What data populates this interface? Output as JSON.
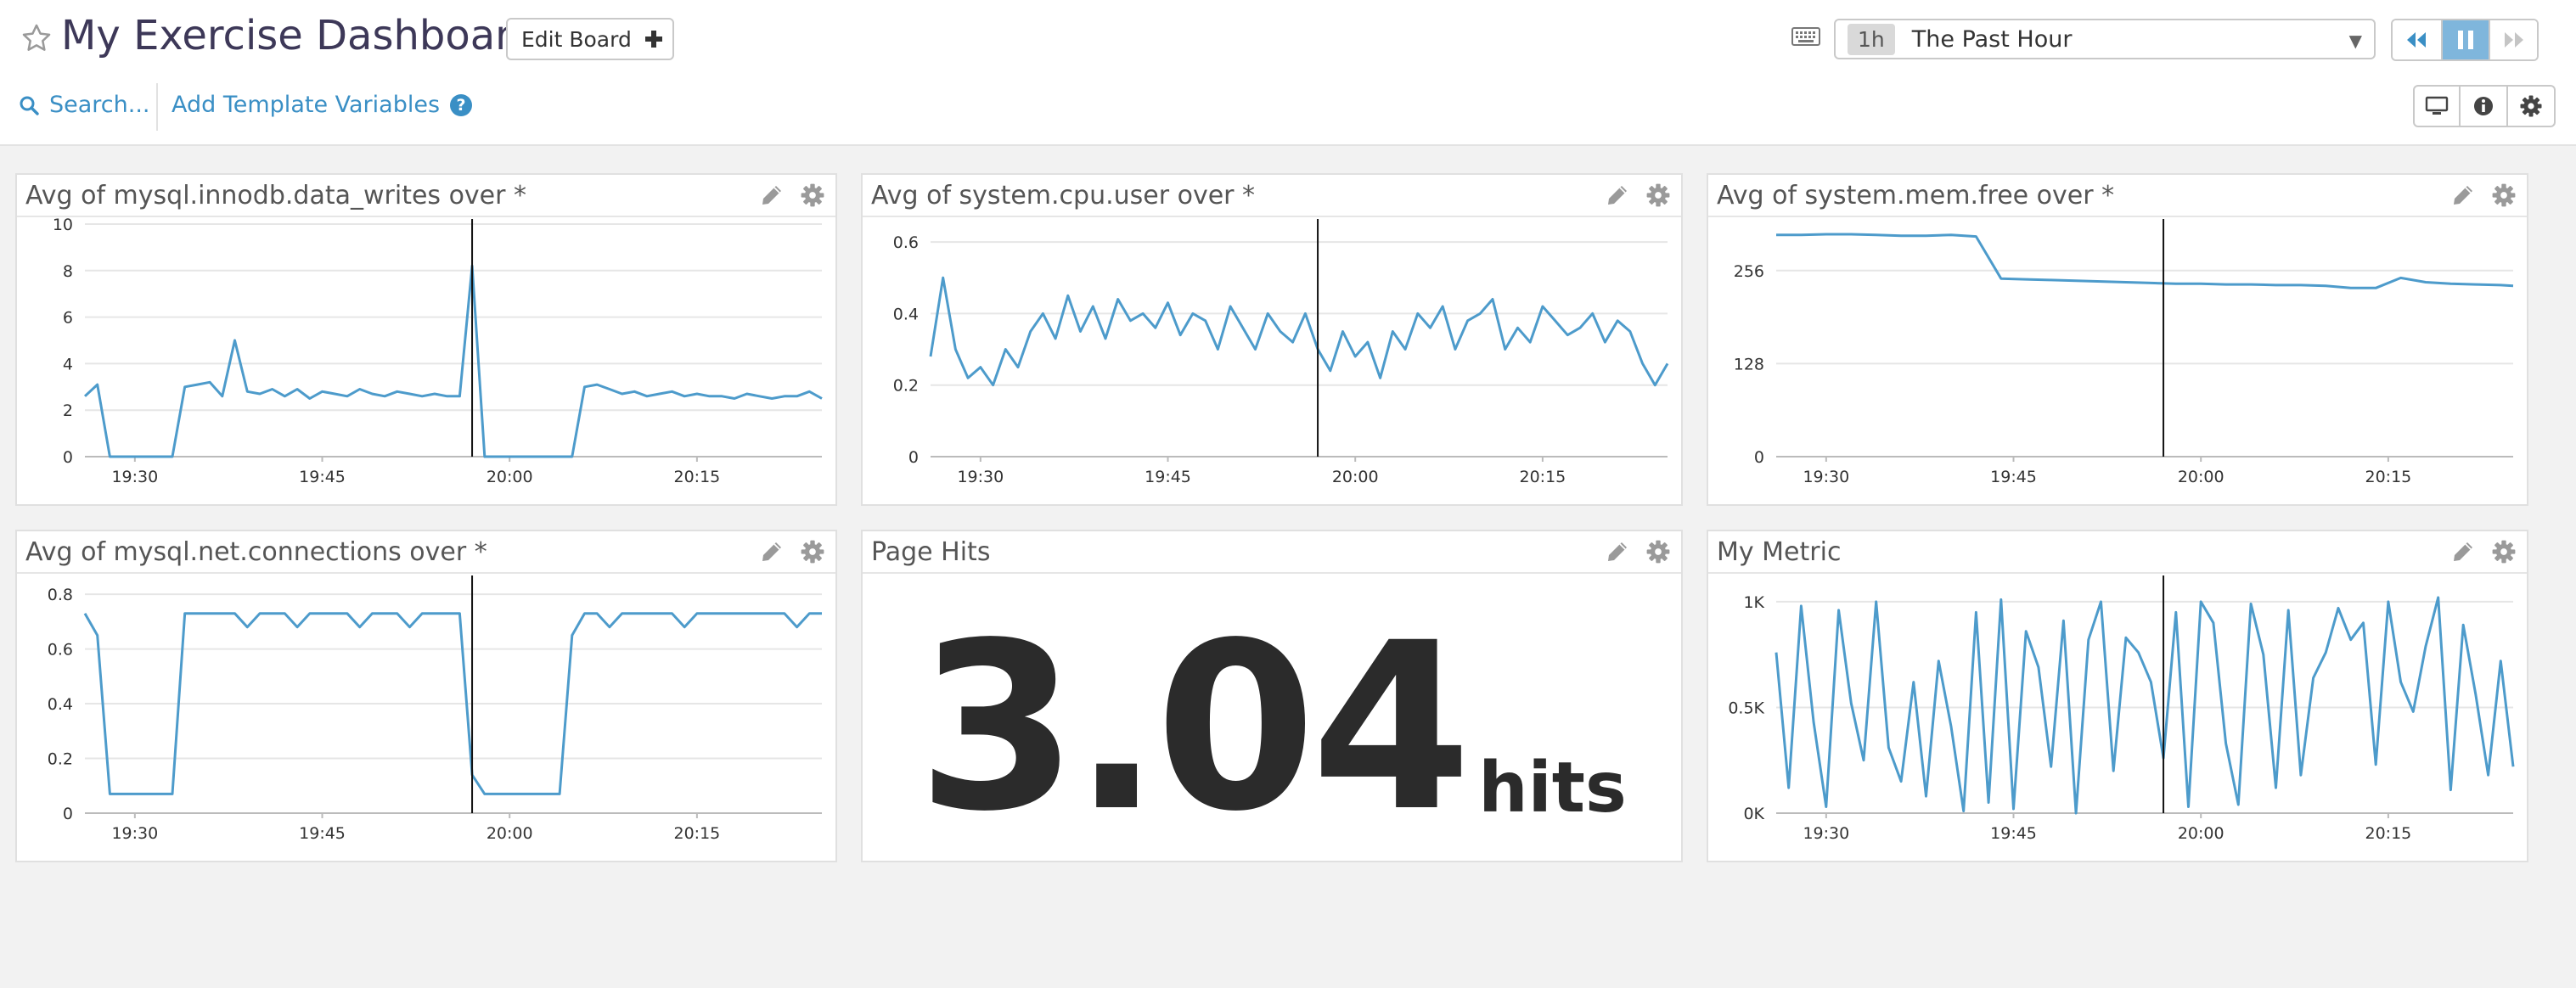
{
  "header": {
    "title": "My Exercise Dashboard",
    "edit_board_label": "Edit Board",
    "time_badge": "1h",
    "time_label": "The Past Hour",
    "search_label": "Search...",
    "template_label": "Add Template Variables"
  },
  "icons": {
    "favorite": "star-icon",
    "edit_board": "plus-icon",
    "keyboard": "keyboard-icon",
    "rewind": "rewind-icon",
    "pause": "pause-icon",
    "forward": "fast-forward-icon",
    "search": "search-icon",
    "help": "question-circle-icon",
    "tv": "tv-mode-icon",
    "info": "info-icon",
    "settings": "gear-icon",
    "widget_edit": "pencil-icon",
    "widget_settings": "gear-icon"
  },
  "colors": {
    "series": "#4d9bcb",
    "link": "#3a8fc5",
    "title": "#3d3858",
    "active_button": "#7fb6dc"
  },
  "widgets": [
    {
      "title": "Avg of mysql.innodb.data_writes over *"
    },
    {
      "title": "Avg of system.cpu.user over *"
    },
    {
      "title": "Avg of system.mem.free over *"
    },
    {
      "title": "Avg of mysql.net.connections over *"
    },
    {
      "title": "Page Hits"
    },
    {
      "title": "My Metric"
    }
  ],
  "page_hits": {
    "value": "3.04",
    "unit": "hits"
  },
  "chart_data": [
    {
      "type": "line",
      "title": "Avg of mysql.innodb.data_writes over *",
      "x": [
        "19:26",
        "19:27",
        "19:28",
        "19:29",
        "19:30",
        "19:31",
        "19:32",
        "19:33",
        "19:34",
        "19:35",
        "19:36",
        "19:37",
        "19:38",
        "19:39",
        "19:40",
        "19:41",
        "19:42",
        "19:43",
        "19:44",
        "19:45",
        "19:46",
        "19:47",
        "19:48",
        "19:49",
        "19:50",
        "19:51",
        "19:52",
        "19:53",
        "19:54",
        "19:55",
        "19:56",
        "19:57",
        "19:58",
        "19:59",
        "20:00",
        "20:01",
        "20:02",
        "20:03",
        "20:04",
        "20:05",
        "20:06",
        "20:07",
        "20:08",
        "20:09",
        "20:10",
        "20:11",
        "20:12",
        "20:13",
        "20:14",
        "20:15",
        "20:16",
        "20:17",
        "20:18",
        "20:19",
        "20:20",
        "20:21",
        "20:22",
        "20:23",
        "20:24",
        "20:25"
      ],
      "series": [
        {
          "values": [
            2.6,
            3.1,
            0,
            0,
            0,
            0,
            0,
            0,
            3.0,
            3.1,
            3.2,
            2.6,
            5.0,
            2.8,
            2.7,
            2.9,
            2.6,
            2.9,
            2.5,
            2.8,
            2.7,
            2.6,
            2.9,
            2.7,
            2.6,
            2.8,
            2.7,
            2.6,
            2.7,
            2.6,
            2.6,
            8.2,
            0,
            0,
            0,
            0,
            0,
            0,
            0,
            0,
            3.0,
            3.1,
            2.9,
            2.7,
            2.8,
            2.6,
            2.7,
            2.8,
            2.6,
            2.7,
            2.6,
            2.6,
            2.5,
            2.7,
            2.6,
            2.5,
            2.6,
            2.6,
            2.8,
            2.5
          ]
        }
      ],
      "ylim": [
        0,
        10
      ],
      "yticks": [
        "0",
        "2",
        "4",
        "6",
        "8",
        "10"
      ],
      "xticks": [
        "19:30",
        "19:45",
        "20:00",
        "20:15"
      ],
      "grid": true
    },
    {
      "type": "line",
      "title": "Avg of system.cpu.user over *",
      "x": [
        "19:26",
        "19:27",
        "19:28",
        "19:29",
        "19:30",
        "19:31",
        "19:32",
        "19:33",
        "19:34",
        "19:35",
        "19:36",
        "19:37",
        "19:38",
        "19:39",
        "19:40",
        "19:41",
        "19:42",
        "19:43",
        "19:44",
        "19:45",
        "19:46",
        "19:47",
        "19:48",
        "19:49",
        "19:50",
        "19:51",
        "19:52",
        "19:53",
        "19:54",
        "19:55",
        "19:56",
        "19:57",
        "19:58",
        "19:59",
        "20:00",
        "20:01",
        "20:02",
        "20:03",
        "20:04",
        "20:05",
        "20:06",
        "20:07",
        "20:08",
        "20:09",
        "20:10",
        "20:11",
        "20:12",
        "20:13",
        "20:14",
        "20:15",
        "20:16",
        "20:17",
        "20:18",
        "20:19",
        "20:20",
        "20:21",
        "20:22",
        "20:23",
        "20:24",
        "20:25"
      ],
      "series": [
        {
          "values": [
            0.28,
            0.5,
            0.3,
            0.22,
            0.25,
            0.2,
            0.3,
            0.25,
            0.35,
            0.4,
            0.33,
            0.45,
            0.35,
            0.42,
            0.33,
            0.44,
            0.38,
            0.4,
            0.36,
            0.43,
            0.34,
            0.4,
            0.38,
            0.3,
            0.42,
            0.36,
            0.3,
            0.4,
            0.35,
            0.32,
            0.4,
            0.3,
            0.24,
            0.35,
            0.28,
            0.32,
            0.22,
            0.35,
            0.3,
            0.4,
            0.36,
            0.42,
            0.3,
            0.38,
            0.4,
            0.44,
            0.3,
            0.36,
            0.32,
            0.42,
            0.38,
            0.34,
            0.36,
            0.4,
            0.32,
            0.38,
            0.35,
            0.26,
            0.2,
            0.26
          ]
        }
      ],
      "ylim": [
        0,
        0.65
      ],
      "yticks": [
        "0",
        "0.2",
        "0.4",
        "0.6"
      ],
      "xticks": [
        "19:30",
        "19:45",
        "20:00",
        "20:15"
      ],
      "grid": true
    },
    {
      "type": "line",
      "title": "Avg of system.mem.free over *",
      "x": [
        "19:26",
        "19:28",
        "19:30",
        "19:32",
        "19:34",
        "19:36",
        "19:38",
        "19:40",
        "19:42",
        "19:44",
        "19:46",
        "19:48",
        "19:50",
        "19:52",
        "19:54",
        "19:56",
        "19:58",
        "20:00",
        "20:02",
        "20:04",
        "20:06",
        "20:08",
        "20:10",
        "20:12",
        "20:14",
        "20:16",
        "20:18",
        "20:20",
        "20:22",
        "20:24",
        "20:25"
      ],
      "series": [
        {
          "values": [
            305,
            305,
            306,
            306,
            305,
            304,
            304,
            305,
            303,
            245,
            244,
            243,
            242,
            241,
            240,
            239,
            238,
            238,
            237,
            237,
            236,
            236,
            235,
            232,
            232,
            246,
            240,
            238,
            237,
            236,
            235
          ]
        }
      ],
      "ylim": [
        0,
        320
      ],
      "yticks": [
        "0",
        "128",
        "256"
      ],
      "xticks": [
        "19:30",
        "19:45",
        "20:00",
        "20:15"
      ],
      "grid": true
    },
    {
      "type": "line",
      "title": "Avg of mysql.net.connections over *",
      "x": [
        "19:26",
        "19:27",
        "19:28",
        "19:29",
        "19:30",
        "19:31",
        "19:32",
        "19:33",
        "19:34",
        "19:35",
        "19:36",
        "19:37",
        "19:38",
        "19:39",
        "19:40",
        "19:41",
        "19:42",
        "19:43",
        "19:44",
        "19:45",
        "19:46",
        "19:47",
        "19:48",
        "19:49",
        "19:50",
        "19:51",
        "19:52",
        "19:53",
        "19:54",
        "19:55",
        "19:56",
        "19:57",
        "19:58",
        "19:59",
        "20:00",
        "20:01",
        "20:02",
        "20:03",
        "20:04",
        "20:05",
        "20:06",
        "20:07",
        "20:08",
        "20:09",
        "20:10",
        "20:11",
        "20:12",
        "20:13",
        "20:14",
        "20:15",
        "20:16",
        "20:17",
        "20:18",
        "20:19",
        "20:20",
        "20:21",
        "20:22",
        "20:23",
        "20:24",
        "20:25"
      ],
      "series": [
        {
          "values": [
            0.73,
            0.65,
            0.07,
            0.07,
            0.07,
            0.07,
            0.07,
            0.07,
            0.73,
            0.73,
            0.73,
            0.73,
            0.73,
            0.68,
            0.73,
            0.73,
            0.73,
            0.68,
            0.73,
            0.73,
            0.73,
            0.73,
            0.68,
            0.73,
            0.73,
            0.73,
            0.68,
            0.73,
            0.73,
            0.73,
            0.73,
            0.14,
            0.07,
            0.07,
            0.07,
            0.07,
            0.07,
            0.07,
            0.07,
            0.65,
            0.73,
            0.73,
            0.68,
            0.73,
            0.73,
            0.73,
            0.73,
            0.73,
            0.68,
            0.73,
            0.73,
            0.73,
            0.73,
            0.73,
            0.73,
            0.73,
            0.73,
            0.68,
            0.73,
            0.73
          ]
        }
      ],
      "ylim": [
        0,
        0.85
      ],
      "yticks": [
        "0",
        "0.2",
        "0.4",
        "0.6",
        "0.8"
      ],
      "xticks": [
        "19:30",
        "19:45",
        "20:00",
        "20:15"
      ],
      "grid": true
    },
    {
      "type": "line",
      "title": "My Metric",
      "x": [
        "19:26",
        "19:27",
        "19:28",
        "19:29",
        "19:30",
        "19:31",
        "19:32",
        "19:33",
        "19:34",
        "19:35",
        "19:36",
        "19:37",
        "19:38",
        "19:39",
        "19:40",
        "19:41",
        "19:42",
        "19:43",
        "19:44",
        "19:45",
        "19:46",
        "19:47",
        "19:48",
        "19:49",
        "19:50",
        "19:51",
        "19:52",
        "19:53",
        "19:54",
        "19:55",
        "19:56",
        "19:57",
        "19:58",
        "19:59",
        "20:00",
        "20:01",
        "20:02",
        "20:03",
        "20:04",
        "20:05",
        "20:06",
        "20:07",
        "20:08",
        "20:09",
        "20:10",
        "20:11",
        "20:12",
        "20:13",
        "20:14",
        "20:15",
        "20:16",
        "20:17",
        "20:18",
        "20:19",
        "20:20",
        "20:21",
        "20:22",
        "20:23",
        "20:24",
        "20:25"
      ],
      "series": [
        {
          "values": [
            760,
            120,
            980,
            430,
            30,
            960,
            520,
            250,
            1000,
            310,
            150,
            620,
            80,
            720,
            410,
            10,
            950,
            50,
            1010,
            20,
            860,
            690,
            220,
            910,
            0,
            820,
            1000,
            200,
            830,
            760,
            620,
            260,
            950,
            30,
            1000,
            900,
            330,
            40,
            990,
            750,
            120,
            960,
            180,
            640,
            760,
            970,
            820,
            900,
            230,
            1000,
            620,
            480,
            790,
            1020,
            110,
            890,
            560,
            180,
            720,
            220
          ]
        }
      ],
      "ylim": [
        0,
        1100
      ],
      "yticks": [
        "0K",
        "0.5K",
        "1K"
      ],
      "xticks": [
        "19:30",
        "19:45",
        "20:00",
        "20:15"
      ],
      "grid": true
    }
  ]
}
